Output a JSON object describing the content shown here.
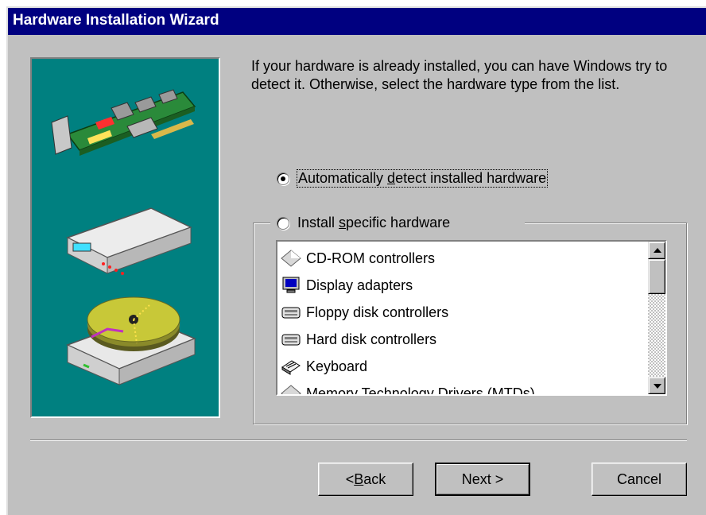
{
  "window": {
    "title": "Hardware Installation Wizard"
  },
  "intro_text": "If your hardware is already installed, you can have Windows try to detect it. Otherwise, select the hardware type from the list.",
  "options": {
    "auto": {
      "before": "Automatically ",
      "accel": "d",
      "after": "etect installed hardware",
      "selected": true
    },
    "specific": {
      "before": "Install ",
      "accel": "s",
      "after": "pecific hardware",
      "selected": false
    }
  },
  "hardware_list": [
    {
      "label": "CD-ROM controllers",
      "icon": "cdrom-controller-icon"
    },
    {
      "label": "Display adapters",
      "icon": "monitor-icon"
    },
    {
      "label": "Floppy disk controllers",
      "icon": "floppy-controller-icon"
    },
    {
      "label": "Hard disk controllers",
      "icon": "hard-disk-controller-icon"
    },
    {
      "label": "Keyboard",
      "icon": "keyboard-icon"
    },
    {
      "label": "Memory Technology Drivers (MTDs)",
      "icon": "memory-icon"
    }
  ],
  "buttons": {
    "back": {
      "before": "< ",
      "accel": "B",
      "after": "ack"
    },
    "next": "Next >",
    "cancel": "Cancel"
  },
  "colors": {
    "titlebar": "#000080",
    "face": "#c0c0c0",
    "art_bg": "#008080"
  }
}
